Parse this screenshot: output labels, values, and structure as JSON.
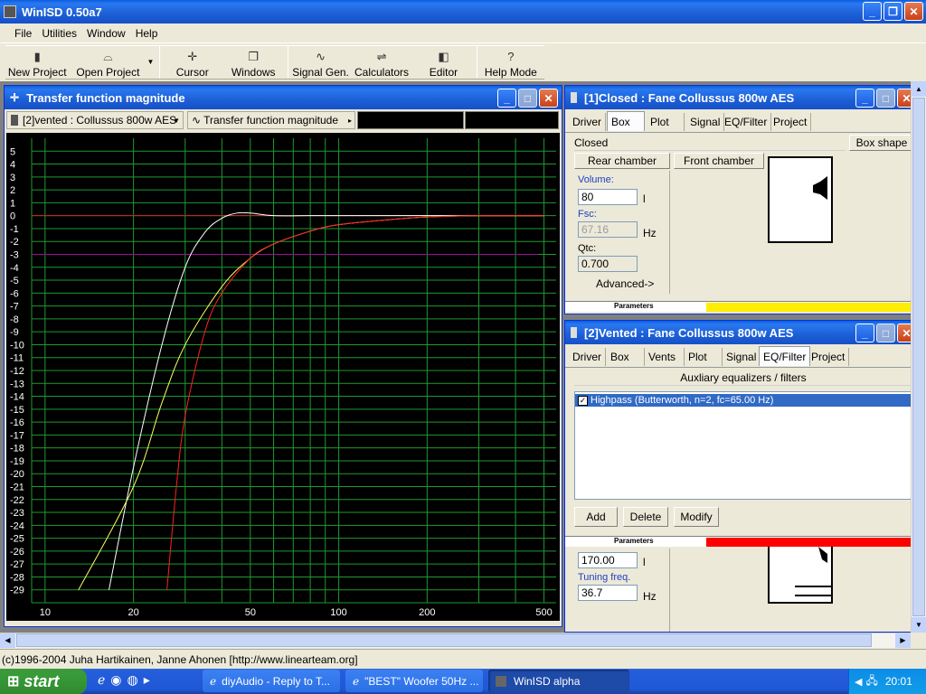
{
  "app": {
    "title": "WinISD 0.50a7"
  },
  "menu": [
    "File",
    "Utilities",
    "Window",
    "Help"
  ],
  "toolbar": [
    {
      "label": "New Project",
      "icon": "new-project-icon"
    },
    {
      "label": "Open Project",
      "icon": "open-project-icon"
    },
    {
      "label": "Cursor",
      "icon": "cursor-icon"
    },
    {
      "label": "Windows",
      "icon": "windows-icon"
    },
    {
      "label": "Signal Gen.",
      "icon": "signal-gen-icon"
    },
    {
      "label": "Calculators",
      "icon": "calculators-icon"
    },
    {
      "label": "Editor",
      "icon": "editor-icon"
    },
    {
      "label": "Help Mode",
      "icon": "help-mode-icon"
    }
  ],
  "plot_window": {
    "title": "Transfer function magnitude",
    "project_select": "[2]vented : Collussus 800w AES",
    "plot_type_select": "Transfer function magnitude"
  },
  "chart_data": {
    "type": "line",
    "x_scale": "log",
    "xlim": [
      9,
      550
    ],
    "ylim": [
      -30,
      6
    ],
    "x_ticks": [
      10,
      20,
      50,
      100,
      200,
      500
    ],
    "y_ticks": [
      5,
      4,
      3,
      2,
      1,
      0,
      -1,
      -2,
      -3,
      -4,
      -5,
      -6,
      -7,
      -8,
      -9,
      -10,
      -11,
      -12,
      -13,
      -14,
      -15,
      -16,
      -17,
      -18,
      -19,
      -20,
      -21,
      -22,
      -23,
      -24,
      -25,
      -26,
      -27,
      -28,
      -29
    ],
    "grid": true,
    "reference_lines": [
      {
        "y": 0,
        "color": "#d02020"
      },
      {
        "y": -3,
        "color": "#a01090"
      }
    ],
    "series": [
      {
        "color": "#ffffff",
        "x": [
          16.5,
          20,
          25,
          30,
          35,
          40,
          45,
          50,
          60,
          80,
          100,
          200,
          500
        ],
        "y": [
          -29,
          -19.5,
          -10,
          -4,
          -1.3,
          -0.2,
          0.2,
          0.2,
          0,
          0,
          0,
          0,
          0
        ]
      },
      {
        "color": "#ffff60",
        "x": [
          13,
          20,
          25,
          30,
          40,
          50,
          60,
          80,
          100,
          150,
          200,
          300,
          500
        ],
        "y": [
          -29,
          -21,
          -14.5,
          -10,
          -5.5,
          -3.3,
          -2.2,
          -1.2,
          -0.7,
          -0.3,
          -0.1,
          0,
          0
        ]
      },
      {
        "color": "#ff2020",
        "x": [
          26,
          28,
          30,
          35,
          40,
          50,
          60,
          80,
          100,
          150,
          200,
          300,
          500
        ],
        "y": [
          -29,
          -21,
          -15.5,
          -9,
          -6,
          -3.3,
          -2.2,
          -1.2,
          -0.7,
          -0.3,
          -0.1,
          0,
          0
        ]
      }
    ]
  },
  "closed_window": {
    "title": "[1]Closed : Fane Collussus 800w AES",
    "tabs": [
      "Driver",
      "Box",
      "Plot",
      "Signal",
      "EQ/Filter",
      "Project"
    ],
    "active_tab": "Box",
    "box_type": "Closed",
    "box_shape_button": "Box shape",
    "rear_chamber": "Rear chamber",
    "front_chamber": "Front chamber",
    "volume_label": "Volume:",
    "volume_value": "80",
    "volume_unit": "l",
    "fsc_label": "Fsc:",
    "fsc_value": "67.16",
    "fsc_unit": "Hz",
    "qtc_label": "Qtc:",
    "qtc_value": "0.700",
    "advanced": "Advanced->",
    "params_label": "Parameters",
    "params_color": "#ffee00"
  },
  "vented_window": {
    "title": "[2]Vented : Fane Collussus 800w AES",
    "tabs": [
      "Driver",
      "Box",
      "Vents",
      "Plot",
      "Signal",
      "EQ/Filter",
      "Project"
    ],
    "active_tab": "EQ/Filter",
    "section": "Auxliary equalizers / filters",
    "filters": [
      {
        "checked": true,
        "label": "Highpass (Butterworth, n=2, fc=65.00 Hz)"
      }
    ],
    "add": "Add",
    "delete": "Delete",
    "modify": "Modify",
    "params_label": "Parameters",
    "params_color": "#ff0000",
    "volume_value": "170.00",
    "volume_unit": "l",
    "tuning_label": "Tuning freq.",
    "tuning_value": "36.7",
    "tuning_unit": "Hz"
  },
  "status": "(c)1996-2004 Juha Hartikainen, Janne Ahonen [http://www.linearteam.org]",
  "taskbar": {
    "start": "start",
    "tasks": [
      "diyAudio - Reply to T...",
      "\"BEST\" Woofer 50Hz ...",
      "WinISD alpha"
    ],
    "clock": "20:01"
  }
}
